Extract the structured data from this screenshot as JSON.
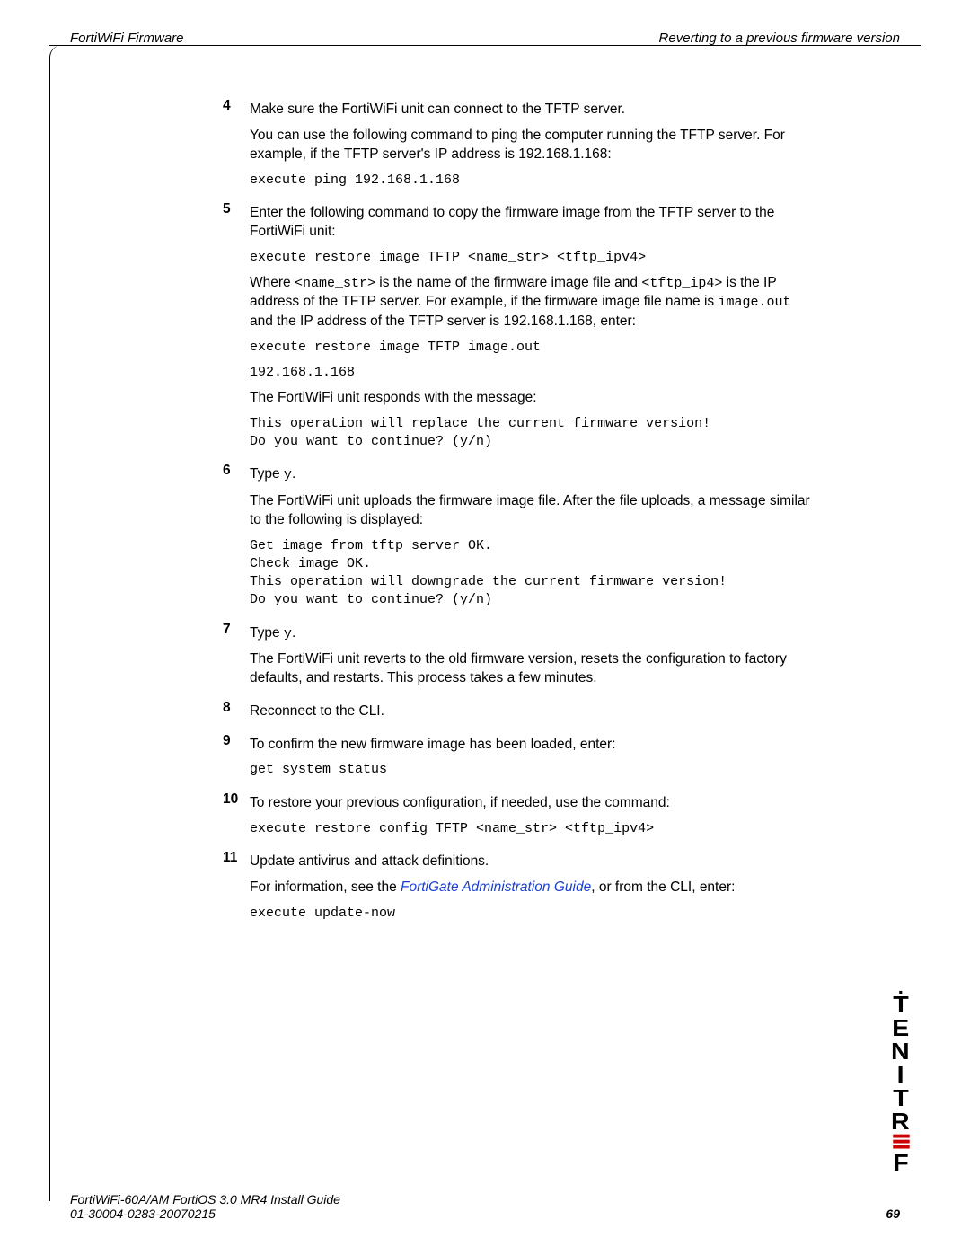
{
  "header": {
    "left": "FortiWiFi Firmware",
    "right": "Reverting to a previous firmware version"
  },
  "steps": [
    {
      "num": "4",
      "parts": [
        {
          "t": "p",
          "text": "Make sure the FortiWiFi unit can connect to the TFTP server."
        },
        {
          "t": "p",
          "text": "You can use the following command to ping the computer running the TFTP server. For example, if the TFTP server's IP address is 192.168.1.168:"
        },
        {
          "t": "code",
          "text": "execute ping 192.168.1.168"
        }
      ]
    },
    {
      "num": "5",
      "parts": [
        {
          "t": "p",
          "text": "Enter the following command to copy the firmware image from the TFTP server to the FortiWiFi unit:"
        },
        {
          "t": "code",
          "text": "execute restore image TFTP <name_str> <tftp_ipv4>"
        },
        {
          "t": "mixed",
          "segments": [
            {
              "text": "Where "
            },
            {
              "mono": true,
              "text": "<name_str>"
            },
            {
              "text": " is the name of the firmware image file and "
            },
            {
              "mono": true,
              "text": "<tftp_ip4>"
            },
            {
              "text": " is the IP address of the TFTP server. For example, if the firmware image file name is "
            },
            {
              "mono": true,
              "text": "image.out"
            },
            {
              "text": " and the IP address of the TFTP server is 192.168.1.168, enter:"
            }
          ]
        },
        {
          "t": "code",
          "text": "execute restore image TFTP image.out"
        },
        {
          "t": "code",
          "text": "192.168.1.168"
        },
        {
          "t": "p",
          "text": "The FortiWiFi unit responds with the message:"
        },
        {
          "t": "code",
          "text": "This operation will replace the current firmware version!\nDo you want to continue? (y/n)"
        }
      ]
    },
    {
      "num": "6",
      "parts": [
        {
          "t": "mixed",
          "segments": [
            {
              "text": "Type "
            },
            {
              "mono": true,
              "text": "y"
            },
            {
              "text": "."
            }
          ]
        },
        {
          "t": "p",
          "text": "The FortiWiFi unit uploads the firmware image file. After the file uploads, a message similar to the following is displayed:"
        },
        {
          "t": "code",
          "text": "Get image from tftp server OK.\nCheck image OK.\nThis operation will downgrade the current firmware version!\nDo you want to continue? (y/n)"
        }
      ]
    },
    {
      "num": "7",
      "parts": [
        {
          "t": "mixed",
          "segments": [
            {
              "text": "Type "
            },
            {
              "mono": true,
              "text": "y"
            },
            {
              "text": "."
            }
          ]
        },
        {
          "t": "p",
          "text": "The FortiWiFi unit reverts to the old firmware version, resets the configuration to factory defaults, and restarts. This process takes a few minutes."
        }
      ]
    },
    {
      "num": "8",
      "parts": [
        {
          "t": "p",
          "text": "Reconnect to the CLI."
        }
      ]
    },
    {
      "num": "9",
      "parts": [
        {
          "t": "p",
          "text": "To confirm the new firmware image has been loaded, enter:"
        },
        {
          "t": "code",
          "text": "get system status"
        }
      ]
    },
    {
      "num": "10",
      "parts": [
        {
          "t": "p",
          "text": "To restore your previous configuration, if needed, use the command:"
        },
        {
          "t": "code",
          "text": "execute restore config TFTP <name_str> <tftp_ipv4>"
        }
      ]
    },
    {
      "num": "11",
      "parts": [
        {
          "t": "p",
          "text": "Update antivirus and attack definitions."
        },
        {
          "t": "mixed",
          "segments": [
            {
              "text": "For information, see the "
            },
            {
              "link": true,
              "text": "FortiGate Administration Guide"
            },
            {
              "text": ", or from the CLI, enter:"
            }
          ]
        },
        {
          "t": "code",
          "text": "execute update-now"
        }
      ]
    }
  ],
  "footer": {
    "line1": "FortiWiFi-60A/AM FortiOS 3.0 MR4 Install Guide",
    "line2": "01-30004-0283-20070215",
    "page": "69"
  },
  "brand": {
    "letters_top": [
      "T",
      "E",
      "N",
      "I",
      "T",
      "R"
    ],
    "letters_bottom": [
      "F"
    ]
  }
}
